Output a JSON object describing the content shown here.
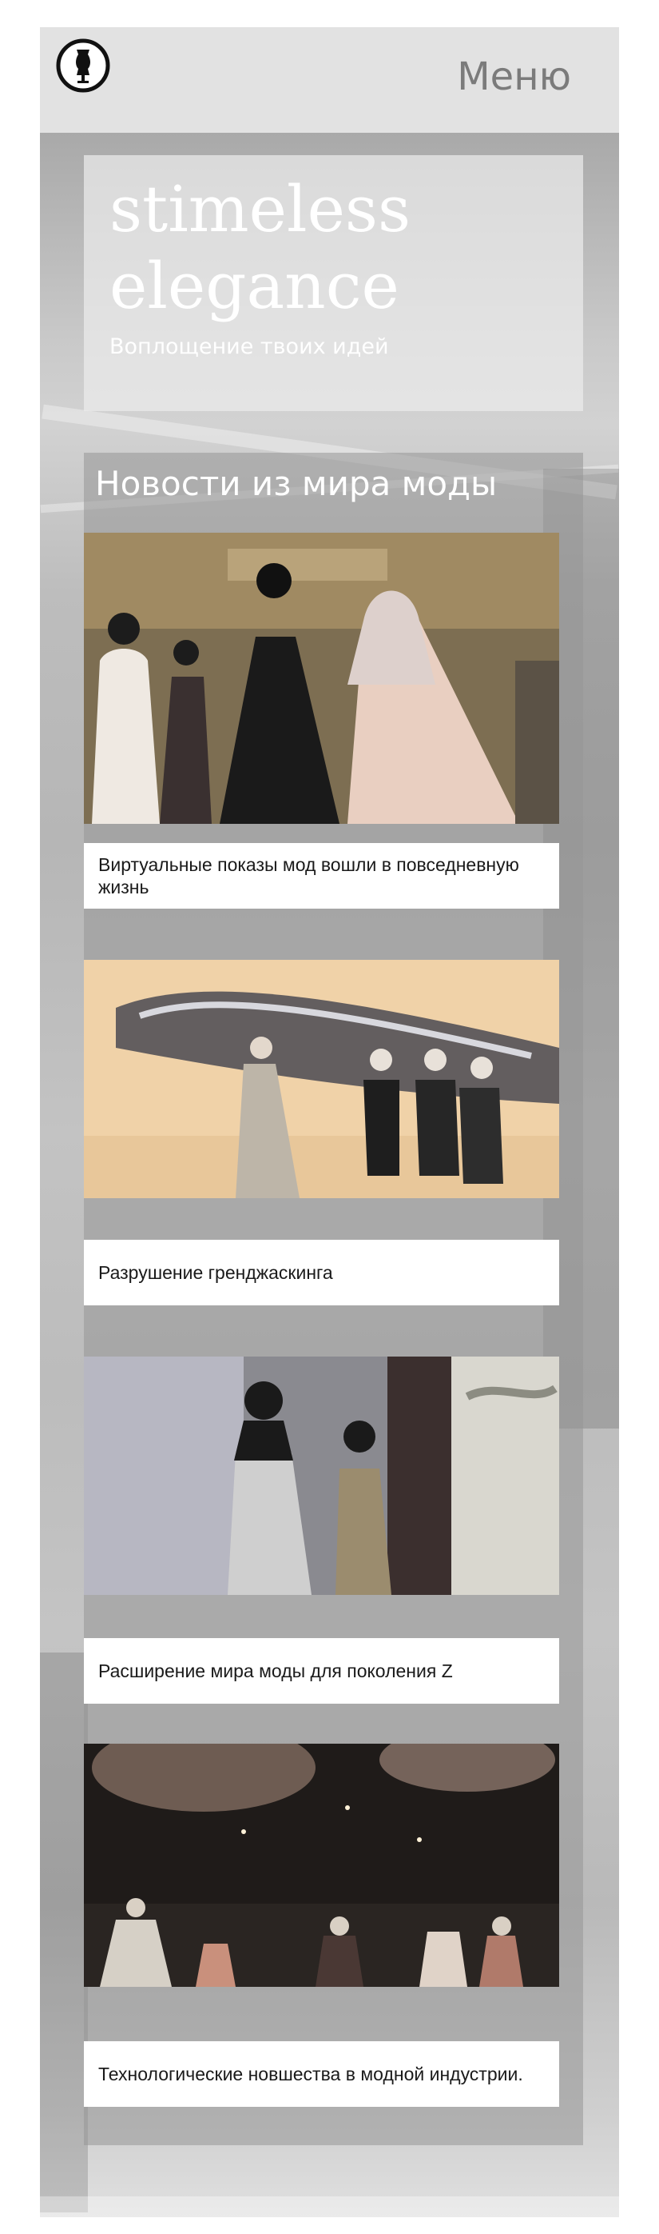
{
  "header": {
    "menu_label": "Меню",
    "logo_icon": "dress-form-icon"
  },
  "hero": {
    "title": "stimeless elegance",
    "subtitle": "Воплощение твоих идей"
  },
  "news": {
    "heading": "Новости из мира моды",
    "items": [
      {
        "title": "Виртуальные показы мод вошли в повседневную жизнь"
      },
      {
        "title": "Разрушение гренджаскинга"
      },
      {
        "title": "Расширение мира моды для поколения Z"
      },
      {
        "title": "Технологические новшества в модной индустрии."
      }
    ]
  },
  "colors": {
    "header_bg": "#e2e2e2",
    "menu_text": "#7b7b7b",
    "card_bg": "#ffffff",
    "heading_text": "#ffffff"
  }
}
